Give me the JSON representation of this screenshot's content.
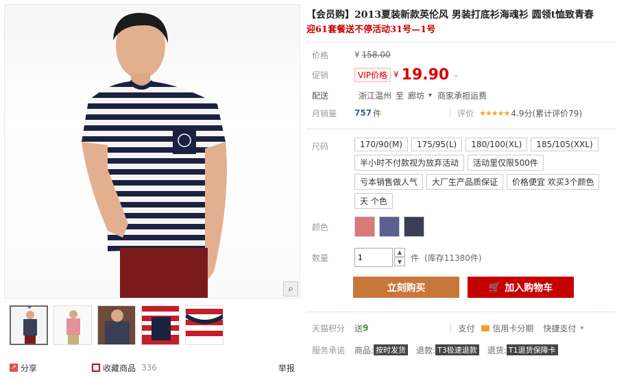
{
  "product": {
    "title": "【会员购】2013夏装新款英伦风 男装打底衫海魂衫 圆领t恤致青春",
    "subtitle": "迎61套餐送不停活动31号—1号"
  },
  "price": {
    "label": "价格",
    "currency": "¥",
    "original": "158.00",
    "promo_label": "促销",
    "vip_tag": "VIP价格",
    "vip_price": "19.90"
  },
  "delivery": {
    "label": "配送",
    "from": "浙江温州",
    "to_word": "至",
    "to": "廊坊",
    "shipping": "商家承担运费"
  },
  "sales": {
    "label": "月销量",
    "count": "757",
    "unit": "件",
    "rating_label": "评价",
    "stars": "★★★★★",
    "score": "4.9分(累计评价79)"
  },
  "sizes": {
    "label": "尺码",
    "options": [
      "170/90(M)",
      "175/95(L)",
      "180/100(XL)",
      "185/105(XXL)",
      "半小时不付款视为放弃活动",
      "活动里仅限500件",
      "亏本销售做人气",
      "大厂生产品质保证",
      "价格便宜 欢买3个颜色",
      "天 个色"
    ]
  },
  "color": {
    "label": "颜色",
    "swatches": [
      "#d97a7a",
      "#5a5f8f",
      "#3b3d54"
    ]
  },
  "quantity": {
    "label": "数量",
    "value": "1",
    "unit": "件",
    "stock": "(库存11380件)"
  },
  "actions": {
    "buy_now": "立刻购买",
    "add_cart": "加入购物车"
  },
  "points": {
    "label": "天猫积分",
    "text": "送",
    "value": "9",
    "pay_label": "支付",
    "credit": "信用卡分期",
    "express": "快捷支付"
  },
  "service": {
    "label": "服务承诺",
    "goods": "商品:",
    "goods_tag": "按时发货",
    "return": "退款:",
    "return_tag": "T3极速退款",
    "exchange": "退货:",
    "exchange_tag": "T1退货保障卡"
  },
  "footer": {
    "share": "分享",
    "favorite": "收藏商品",
    "fav_count": "336",
    "report": "举报"
  },
  "colors": {
    "accent_red": "#c40000",
    "buy_orange": "#c8773b"
  }
}
